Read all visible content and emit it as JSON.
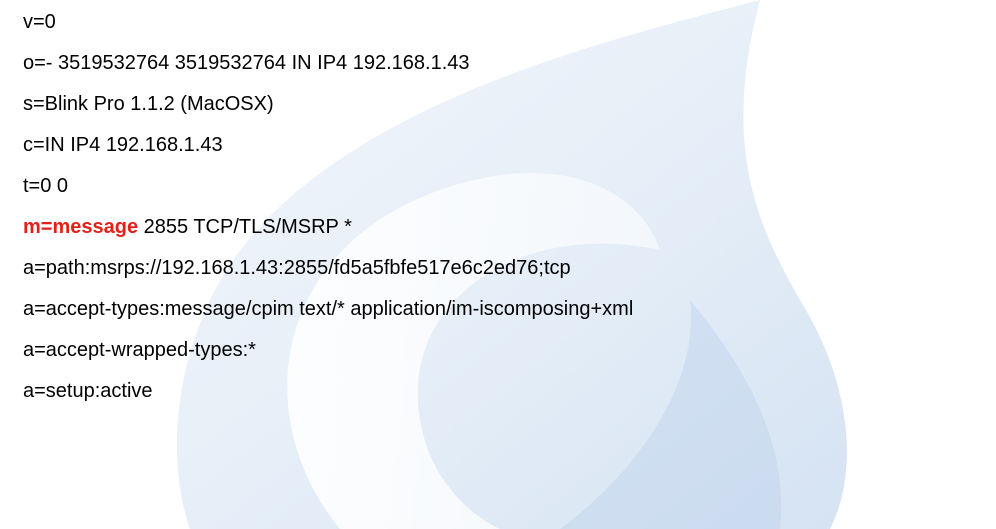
{
  "sdp": {
    "lines": [
      "v=0",
      "o=- 3519532764 3519532764 IN IP4 192.168.1.43",
      "s=Blink Pro 1.1.2 (MacOSX)",
      "c=IN IP4 192.168.1.43",
      "t=0 0",
      "m=message",
      "a=path:msrps://192.168.1.43:2855/fd5a5fbfe517e6c2ed76;tcp",
      "a=accept-types:message/cpim text/* application/im-iscomposing+xml",
      "a=accept-wrapped-types:*",
      "a=setup:active"
    ],
    "media_line": {
      "keyword": "m=message",
      "rest": " 2855 TCP/TLS/MSRP *"
    }
  },
  "colors": {
    "highlight": "#e32119",
    "text": "#000000",
    "watermark": "#d9e6f4"
  },
  "watermark_icon": "blink-flame-logo"
}
